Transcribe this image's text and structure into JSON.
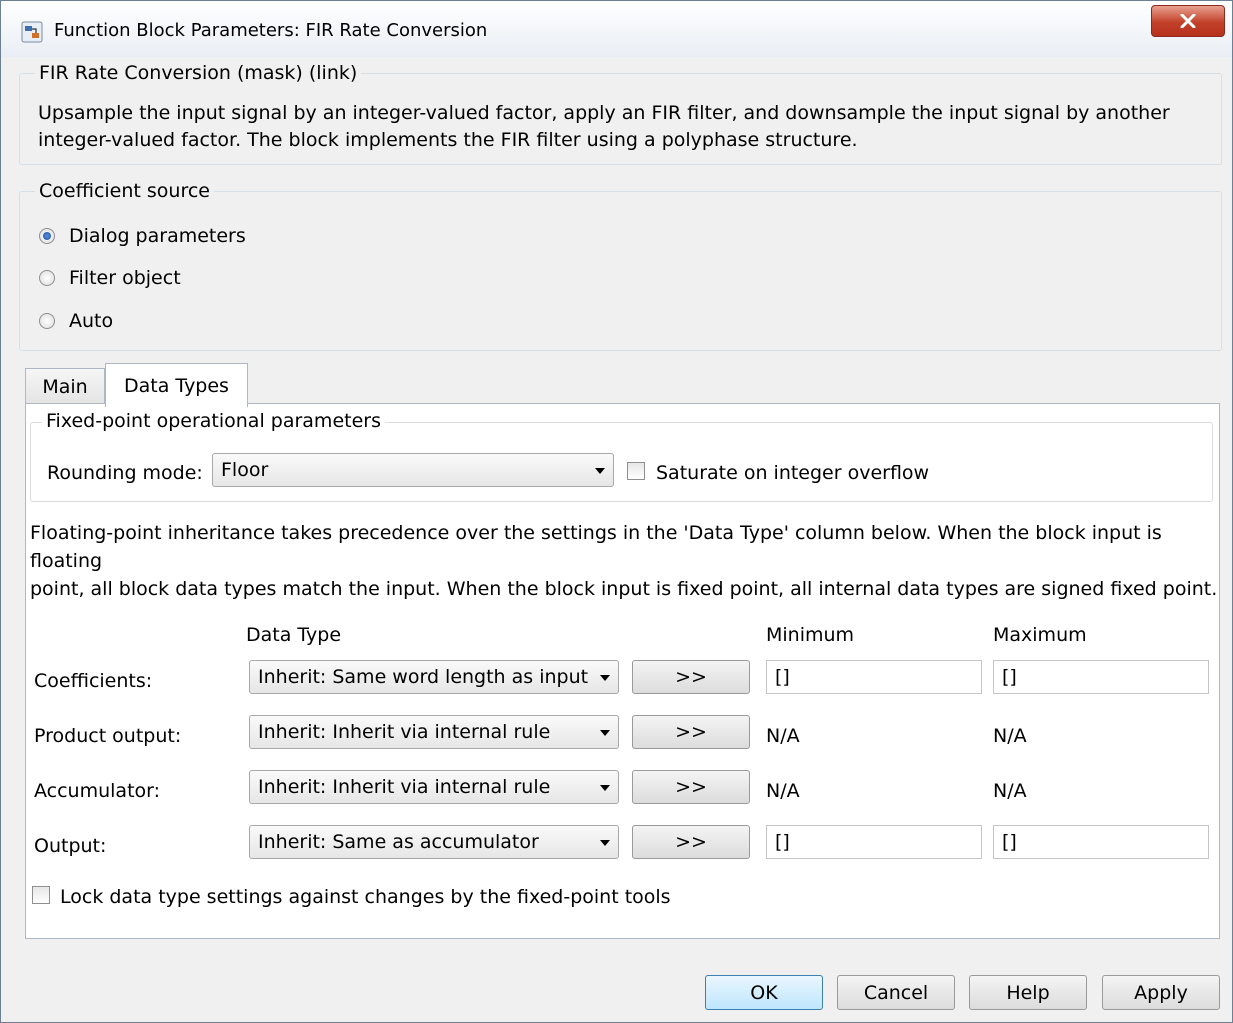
{
  "window": {
    "title": "Function Block Parameters: FIR Rate Conversion"
  },
  "mask": {
    "group_title": "FIR Rate Conversion (mask) (link)",
    "description_line1": "Upsample the input signal by an integer-valued factor, apply an FIR filter, and downsample the input signal by another",
    "description_line2": "integer-valued factor. The block implements the FIR filter using a polyphase structure."
  },
  "coefficient_source": {
    "group_title": "Coefficient source",
    "options": [
      "Dialog parameters",
      "Filter object",
      "Auto"
    ],
    "selected": "Dialog parameters"
  },
  "tabs": {
    "items": [
      "Main",
      "Data Types"
    ],
    "active": "Data Types"
  },
  "fixed_point": {
    "group_title": "Fixed-point operational parameters",
    "rounding_label": "Rounding mode:",
    "rounding_value": "Floor",
    "saturate_label": "Saturate on integer overflow",
    "saturate_checked": false
  },
  "info_text": {
    "line1": "Floating-point inheritance takes precedence over the settings in the 'Data Type' column below. When the block input is floating",
    "line2": "point, all block data types match the input. When the block input is fixed point, all internal data types are signed fixed point."
  },
  "table": {
    "headers": {
      "data_type": "Data Type",
      "minimum": "Minimum",
      "maximum": "Maximum"
    },
    "rows": [
      {
        "label": "Coefficients:",
        "type": "Inherit: Same word length as input",
        "button": ">>",
        "min": "[]",
        "max": "[]"
      },
      {
        "label": "Product output:",
        "type": "Inherit: Inherit via internal rule",
        "button": ">>",
        "min": "N/A",
        "max": "N/A"
      },
      {
        "label": "Accumulator:",
        "type": "Inherit: Inherit via internal rule",
        "button": ">>",
        "min": "N/A",
        "max": "N/A"
      },
      {
        "label": "Output:",
        "type": "Inherit: Same as accumulator",
        "button": ">>",
        "min": "[]",
        "max": "[]"
      }
    ]
  },
  "lock": {
    "label": "Lock data type settings against changes by the fixed-point tools",
    "checked": false
  },
  "buttons": {
    "ok": "OK",
    "cancel": "Cancel",
    "help": "Help",
    "apply": "Apply"
  },
  "colors": {
    "accent": "#3c7fb1",
    "close": "#c2402a"
  }
}
